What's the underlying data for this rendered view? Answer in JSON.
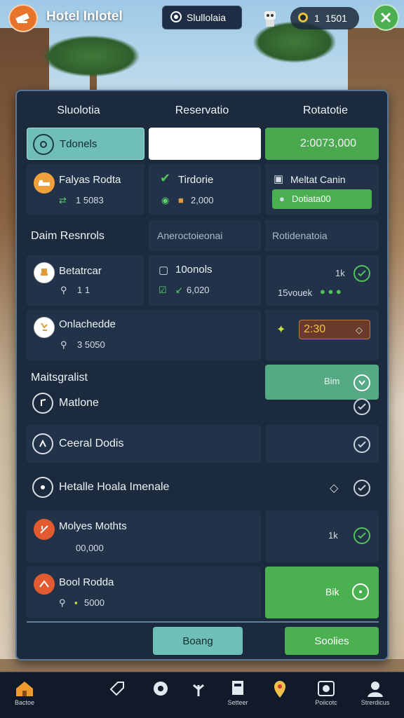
{
  "header": {
    "title": "Hotel Inlotel",
    "center_label": "Slullolaia",
    "coin_amount_a": "1",
    "coin_amount_b": "1501"
  },
  "tabs": [
    "Sluolotia",
    "Reservatio",
    "Rotatotie"
  ],
  "row1": {
    "teal_label": "Tdonels",
    "green_value": "2:0073,000"
  },
  "row2": {
    "a_title": "Falyas Rodta",
    "a_sub": "1 5083",
    "b_title": "Tirdorie",
    "b_sub": "2,000",
    "c_title": "Meltat Canin",
    "c_button": "Dotiata00"
  },
  "section1": {
    "title": "Daim Resnrols",
    "mid": "Aneroctoieonai",
    "right": "Rotidenatoia"
  },
  "row3": {
    "a_title": "Betatrcar",
    "a_sub": "1 1",
    "b_title": "10onols",
    "b_sub": "6,020",
    "c_small": "1k",
    "c_sub": "15vouek"
  },
  "row4": {
    "a_title": "Onlachedde",
    "a_sub": "3 5050",
    "value": "2:30"
  },
  "section2": {
    "title": "Maitsgralist",
    "button": "Bim"
  },
  "list": [
    {
      "title": "Matlone"
    },
    {
      "title": "Ceeral Dodis"
    },
    {
      "title": "Hetalle Hoala Imenale"
    }
  ],
  "row5": {
    "title": "Molyes Mothts",
    "sub": "00,000",
    "right": "1k"
  },
  "row6": {
    "title": "Bool Rodda",
    "sub": "5000",
    "button": "Bik"
  },
  "buttons": {
    "left": "Boang",
    "right": "Soolies"
  },
  "nav": [
    {
      "label": "Bactoe",
      "icon": "home-icon"
    },
    {
      "label": "",
      "icon": "tag-icon"
    },
    {
      "label": "",
      "icon": "service-icon"
    },
    {
      "label": "",
      "icon": "plant-icon"
    },
    {
      "label": "Setteer",
      "icon": "door-icon"
    },
    {
      "label": "",
      "icon": "map-pin-icon"
    },
    {
      "label": "Poiicotc",
      "icon": "gallery-icon"
    },
    {
      "label": "Strerdicus",
      "icon": "profile-icon"
    }
  ],
  "colors": {
    "accent_green": "#4bb04f",
    "accent_teal": "#6fbfb8",
    "panel": "#1c2a3d",
    "logo": "#e8742c"
  }
}
